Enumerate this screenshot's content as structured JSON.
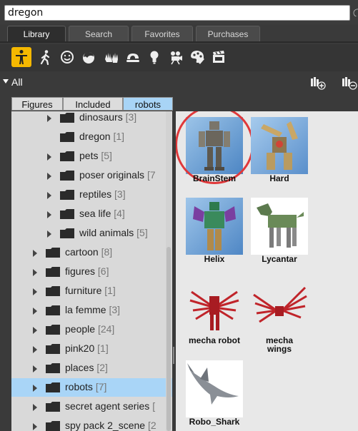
{
  "search": {
    "value": "dregon"
  },
  "tabs": [
    {
      "label": "Library",
      "active": true
    },
    {
      "label": "Search",
      "active": false
    },
    {
      "label": "Favorites",
      "active": false
    },
    {
      "label": "Purchases",
      "active": false
    }
  ],
  "toolbar": {
    "icons": [
      "figures-icon",
      "poses-icon",
      "expressions-icon",
      "hair-icon",
      "hands-icon",
      "props-icon",
      "lights-icon",
      "cameras-icon",
      "materials-icon",
      "scenes-icon"
    ],
    "active_index": 0,
    "accent_color": "#f5b800"
  },
  "filter": {
    "label": "All"
  },
  "breadcrumb": [
    "Figures",
    "Included",
    "robots"
  ],
  "tree": [
    {
      "label": "dinosaurs",
      "count": "[3]",
      "level": 2,
      "expandable": true
    },
    {
      "label": "dregon",
      "count": "[1]",
      "level": 2,
      "expandable": false
    },
    {
      "label": "pets",
      "count": "[5]",
      "level": 2,
      "expandable": true
    },
    {
      "label": "poser originals",
      "count": "[7",
      "level": 2,
      "expandable": true
    },
    {
      "label": "reptiles",
      "count": "[3]",
      "level": 2,
      "expandable": true
    },
    {
      "label": "sea life",
      "count": "[4]",
      "level": 2,
      "expandable": true
    },
    {
      "label": "wild animals",
      "count": "[5]",
      "level": 2,
      "expandable": true
    },
    {
      "label": "cartoon",
      "count": "[8]",
      "level": 1,
      "expandable": true
    },
    {
      "label": "figures",
      "count": "[6]",
      "level": 1,
      "expandable": true
    },
    {
      "label": "furniture",
      "count": "[1]",
      "level": 1,
      "expandable": true
    },
    {
      "label": "la femme",
      "count": "[3]",
      "level": 1,
      "expandable": true
    },
    {
      "label": "people",
      "count": "[24]",
      "level": 1,
      "expandable": true
    },
    {
      "label": "pink20",
      "count": "[1]",
      "level": 1,
      "expandable": true
    },
    {
      "label": "places",
      "count": "[2]",
      "level": 1,
      "expandable": true
    },
    {
      "label": "robots",
      "count": "[7]",
      "level": 1,
      "expandable": true,
      "selected": true
    },
    {
      "label": "secret agent series",
      "count": "[",
      "level": 1,
      "expandable": true
    },
    {
      "label": "spy pack 2_scene",
      "count": "[2",
      "level": 1,
      "expandable": true
    }
  ],
  "items": [
    {
      "label": "BrainStem",
      "highlighted": true
    },
    {
      "label": "Hard",
      "highlighted": false
    },
    {
      "label": "Helix",
      "highlighted": false
    },
    {
      "label": "Lycantar",
      "highlighted": false
    },
    {
      "label": "mecha robot",
      "highlighted": false
    },
    {
      "label": "mecha wings",
      "highlighted": false
    },
    {
      "label": "Robo_Shark",
      "highlighted": false
    }
  ]
}
